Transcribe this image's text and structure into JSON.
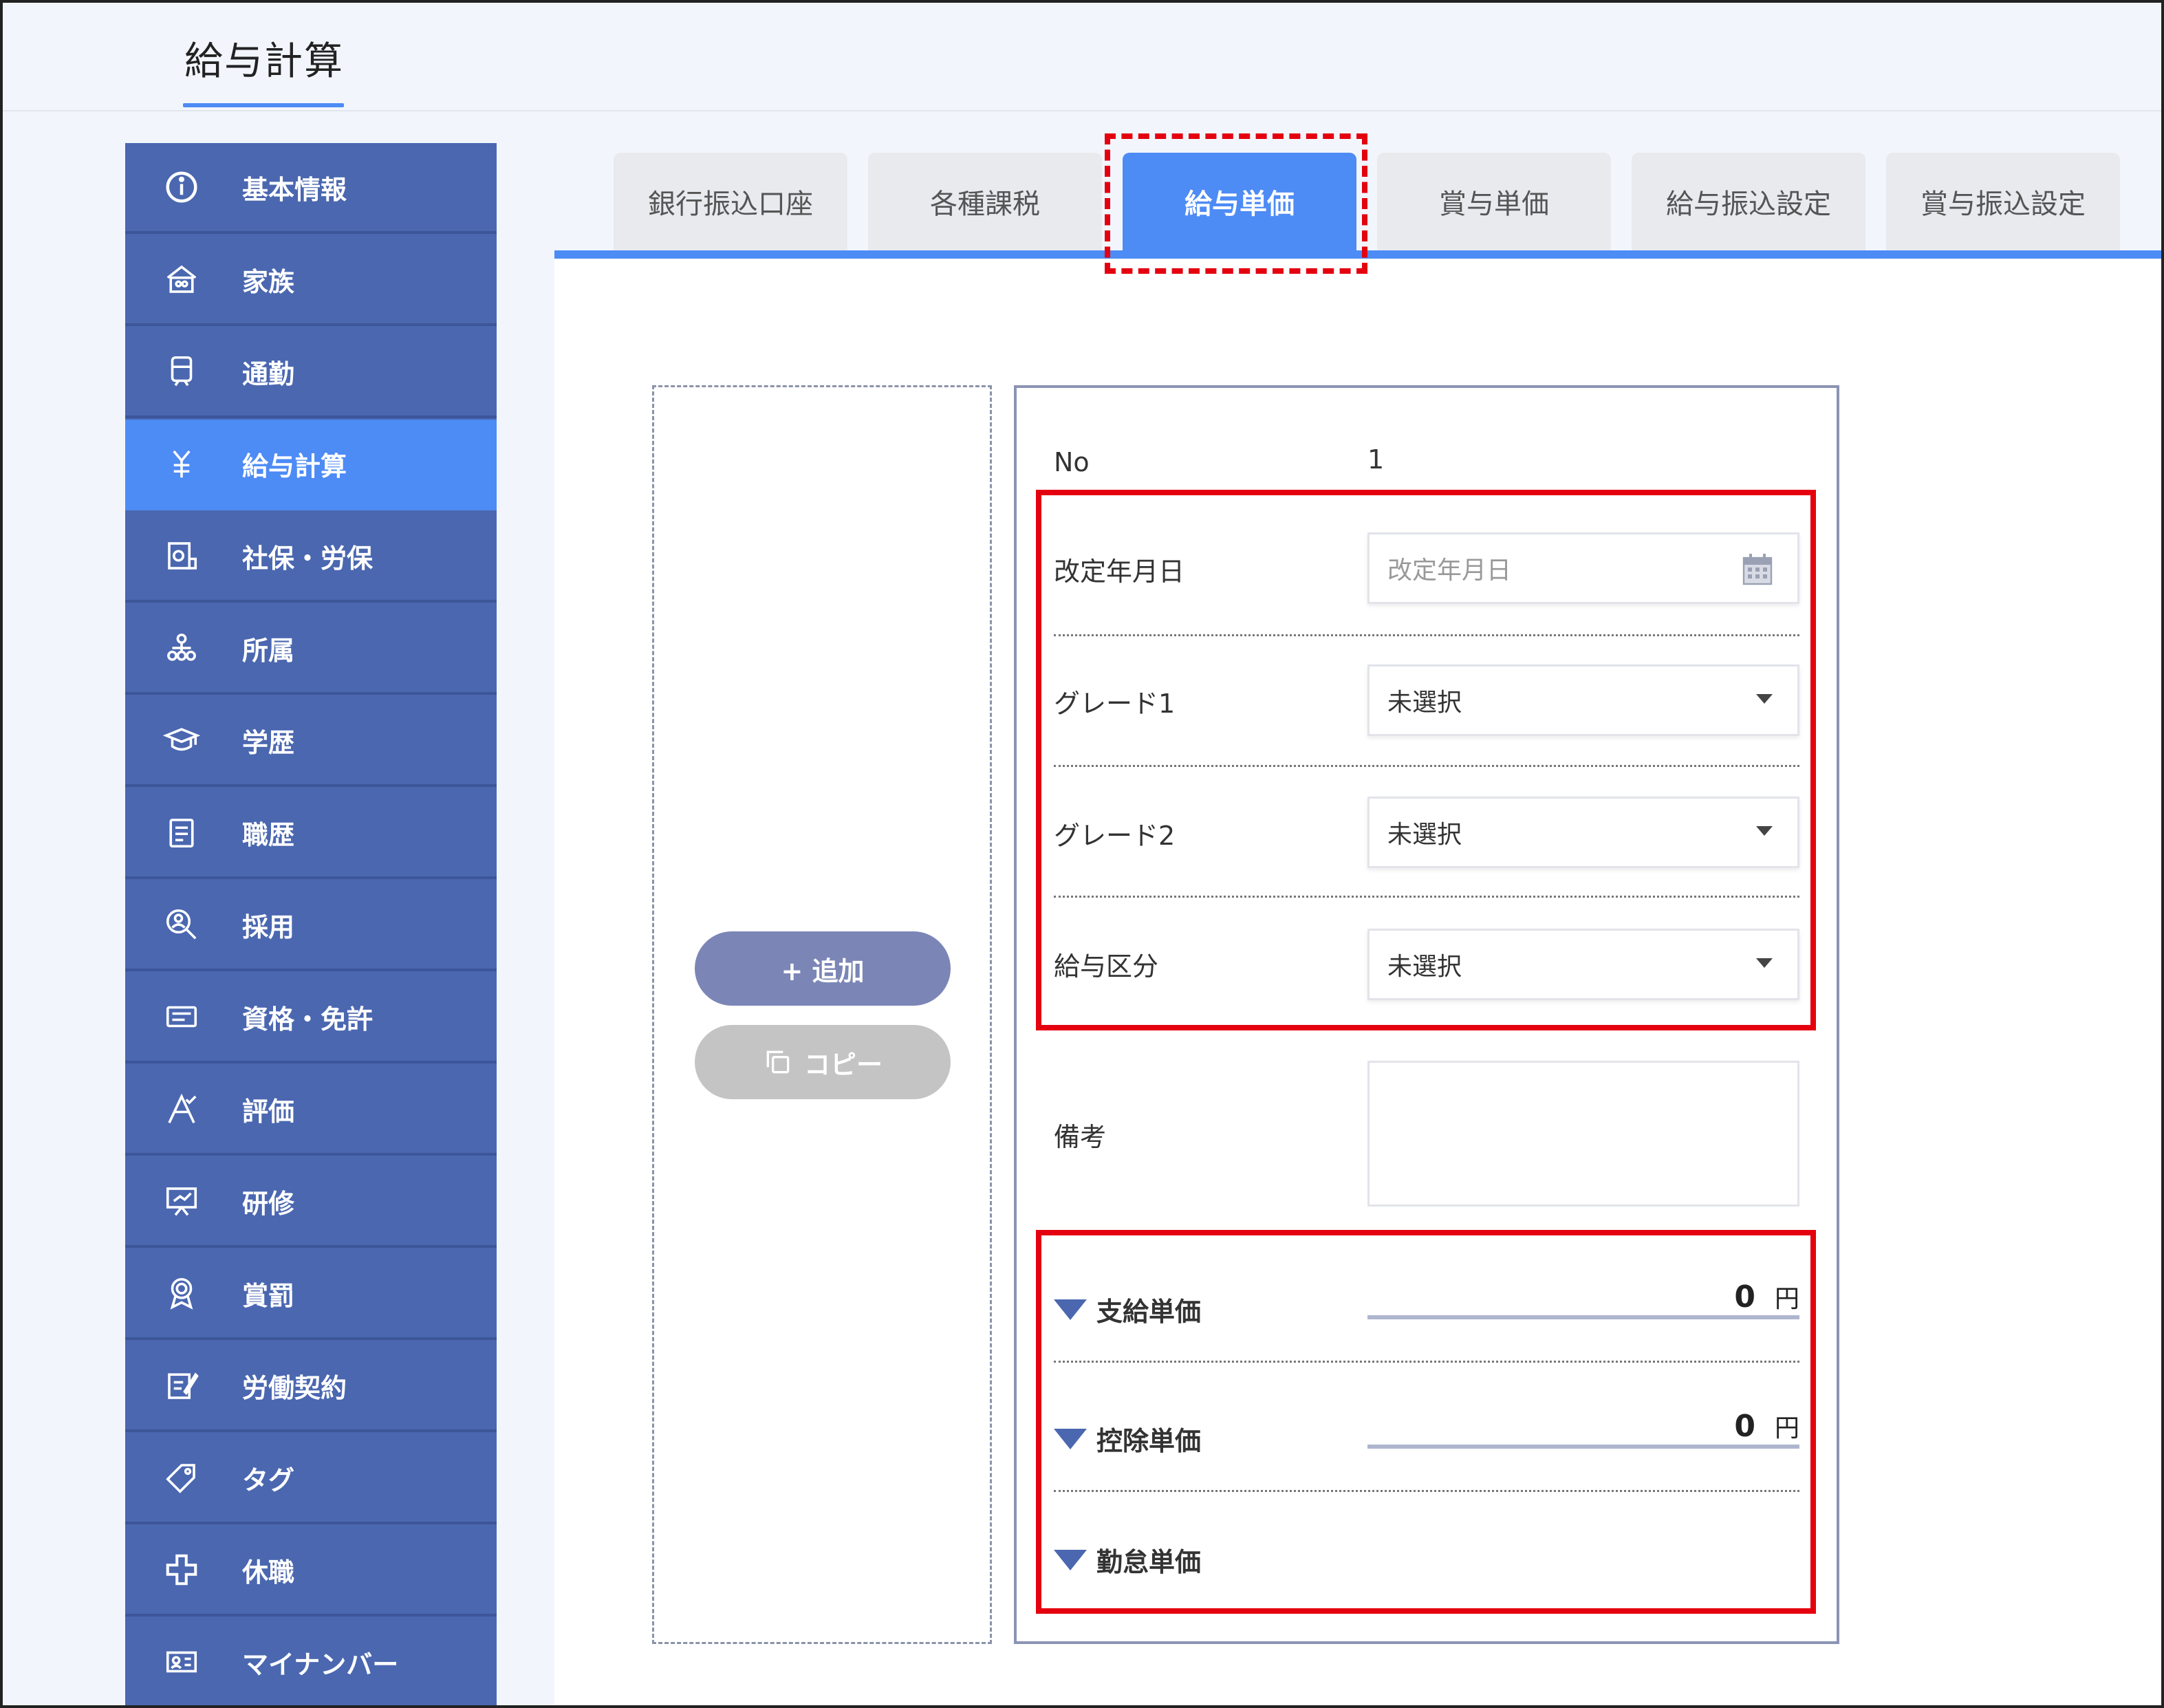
{
  "page": {
    "title": "給与計算"
  },
  "sidebar": {
    "items": [
      {
        "label": "基本情報",
        "icon": "info-icon"
      },
      {
        "label": "家族",
        "icon": "house-icon"
      },
      {
        "label": "通勤",
        "icon": "train-icon"
      },
      {
        "label": "給与計算",
        "icon": "payroll-icon",
        "active": true
      },
      {
        "label": "社保・労保",
        "icon": "insurance-icon"
      },
      {
        "label": "所属",
        "icon": "org-chart-icon"
      },
      {
        "label": "学歴",
        "icon": "graduation-cap-icon"
      },
      {
        "label": "職歴",
        "icon": "resume-icon"
      },
      {
        "label": "採用",
        "icon": "recruit-search-icon"
      },
      {
        "label": "資格・免許",
        "icon": "license-card-icon"
      },
      {
        "label": "評価",
        "icon": "evaluation-icon"
      },
      {
        "label": "研修",
        "icon": "training-board-icon"
      },
      {
        "label": "賞罰",
        "icon": "award-icon"
      },
      {
        "label": "労働契約",
        "icon": "contract-icon"
      },
      {
        "label": "タグ",
        "icon": "tag-icon"
      },
      {
        "label": "休職",
        "icon": "leave-cross-icon"
      },
      {
        "label": "マイナンバー",
        "icon": "id-card-icon"
      }
    ]
  },
  "tabs": [
    {
      "label": "銀行振込口座"
    },
    {
      "label": "各種課税"
    },
    {
      "label": "給与単価",
      "active": true
    },
    {
      "label": "賞与単価"
    },
    {
      "label": "給与振込設定"
    },
    {
      "label": "賞与振込設定"
    }
  ],
  "list_actions": {
    "add_label": "+ 追加",
    "copy_label": "コピー"
  },
  "form": {
    "no_label": "No",
    "no_value": "1",
    "revision_date": {
      "label": "改定年月日",
      "placeholder": "改定年月日"
    },
    "grade1": {
      "label": "グレード1",
      "value": "未選択"
    },
    "grade2": {
      "label": "グレード2",
      "value": "未選択"
    },
    "salary_class": {
      "label": "給与区分",
      "value": "未選択"
    },
    "remarks": {
      "label": "備考",
      "value": ""
    },
    "sections": {
      "pay_rate": {
        "label": "支給単価",
        "amount": "0",
        "unit": "円"
      },
      "deduction_rate": {
        "label": "控除単価",
        "amount": "0",
        "unit": "円"
      },
      "attendance_rate": {
        "label": "勤怠単価"
      }
    }
  },
  "colors": {
    "sidebar": "#4a67b0",
    "accent": "#4d8bf5",
    "highlight": "#e4000f",
    "add_button": "#7b86b6",
    "copy_button": "#c4c4c4"
  }
}
